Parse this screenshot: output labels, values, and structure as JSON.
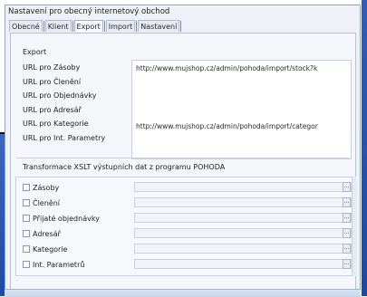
{
  "window": {
    "title": "Nastavení pro obecný internetový obchod"
  },
  "tabs": [
    {
      "label": "Obecné",
      "active": false
    },
    {
      "label": "Klient",
      "active": false
    },
    {
      "label": "Export",
      "active": true
    },
    {
      "label": "Import",
      "active": false
    },
    {
      "label": "Nastavení",
      "active": false
    }
  ],
  "export": {
    "section_title": "Export",
    "rows": [
      {
        "label": "URL pro Zásoby",
        "value": "http://www.mujshop.cz/admin/pohoda/import/stock?k"
      },
      {
        "label": "URL pro Členění",
        "value": ""
      },
      {
        "label": "URL pro Objednávky",
        "value": ""
      },
      {
        "label": "URL pro Adresář",
        "value": ""
      },
      {
        "label": "URL pro Kategorie",
        "value": "http://www.mujshop.cz/admin/pohoda/import/categor"
      },
      {
        "label": "URL pro Int. Parametry",
        "value": ""
      }
    ]
  },
  "xslt": {
    "section_title": "Transformace XSLT výstupních dat z programu POHODA",
    "browse_label": "...",
    "rows": [
      {
        "label": "Zásoby",
        "checked": false,
        "value": ""
      },
      {
        "label": "Členění",
        "checked": false,
        "value": ""
      },
      {
        "label": "Přijaté objednávky",
        "checked": false,
        "value": ""
      },
      {
        "label": "Adresář",
        "checked": false,
        "value": ""
      },
      {
        "label": "Kategorie",
        "checked": false,
        "value": ""
      },
      {
        "label": "Int. Parametrů",
        "checked": false,
        "value": ""
      }
    ]
  },
  "colors": {
    "accent": "#2e5dbd",
    "panel": "#f4f6fa",
    "window": "#eef2f8"
  }
}
